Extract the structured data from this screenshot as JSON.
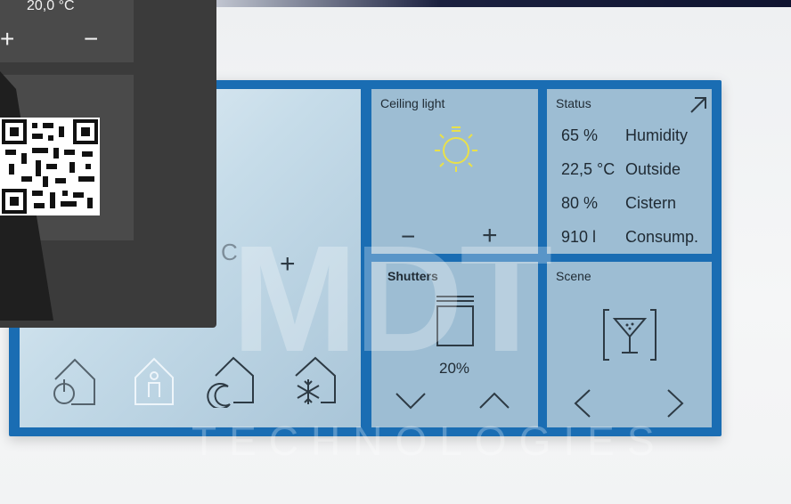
{
  "overlay": {
    "temperature": "20,0 °C",
    "plus": "+",
    "minus": "−"
  },
  "left_panel": {
    "partial_unit": "C",
    "plus": "+",
    "mode_icons": [
      "home-power-icon",
      "home-person-icon",
      "home-night-icon",
      "home-frost-icon"
    ]
  },
  "watermark": {
    "big": "MDT",
    "small": "TECHNOLOGIES"
  },
  "ceiling_light": {
    "title": "Ceiling light",
    "icon": "sun-icon",
    "minus": "−",
    "plus": "+",
    "color": "#e9e04a"
  },
  "status": {
    "title": "Status",
    "rows": [
      {
        "value": "65 %",
        "label": "Humidity"
      },
      {
        "value": "22,5 °C",
        "label": "Outside"
      },
      {
        "value": "80 %",
        "label": "Cistern"
      },
      {
        "value": "910 l",
        "label": "Consump."
      }
    ]
  },
  "shutters": {
    "title": "Shutters",
    "percent": "20%",
    "level": 0.2
  },
  "scene": {
    "title": "Scene",
    "icon": "cocktail-icon"
  },
  "colors": {
    "frame": "#1a6db3",
    "tile": "#a8c4d6",
    "overlay": "#3b3b3b"
  }
}
